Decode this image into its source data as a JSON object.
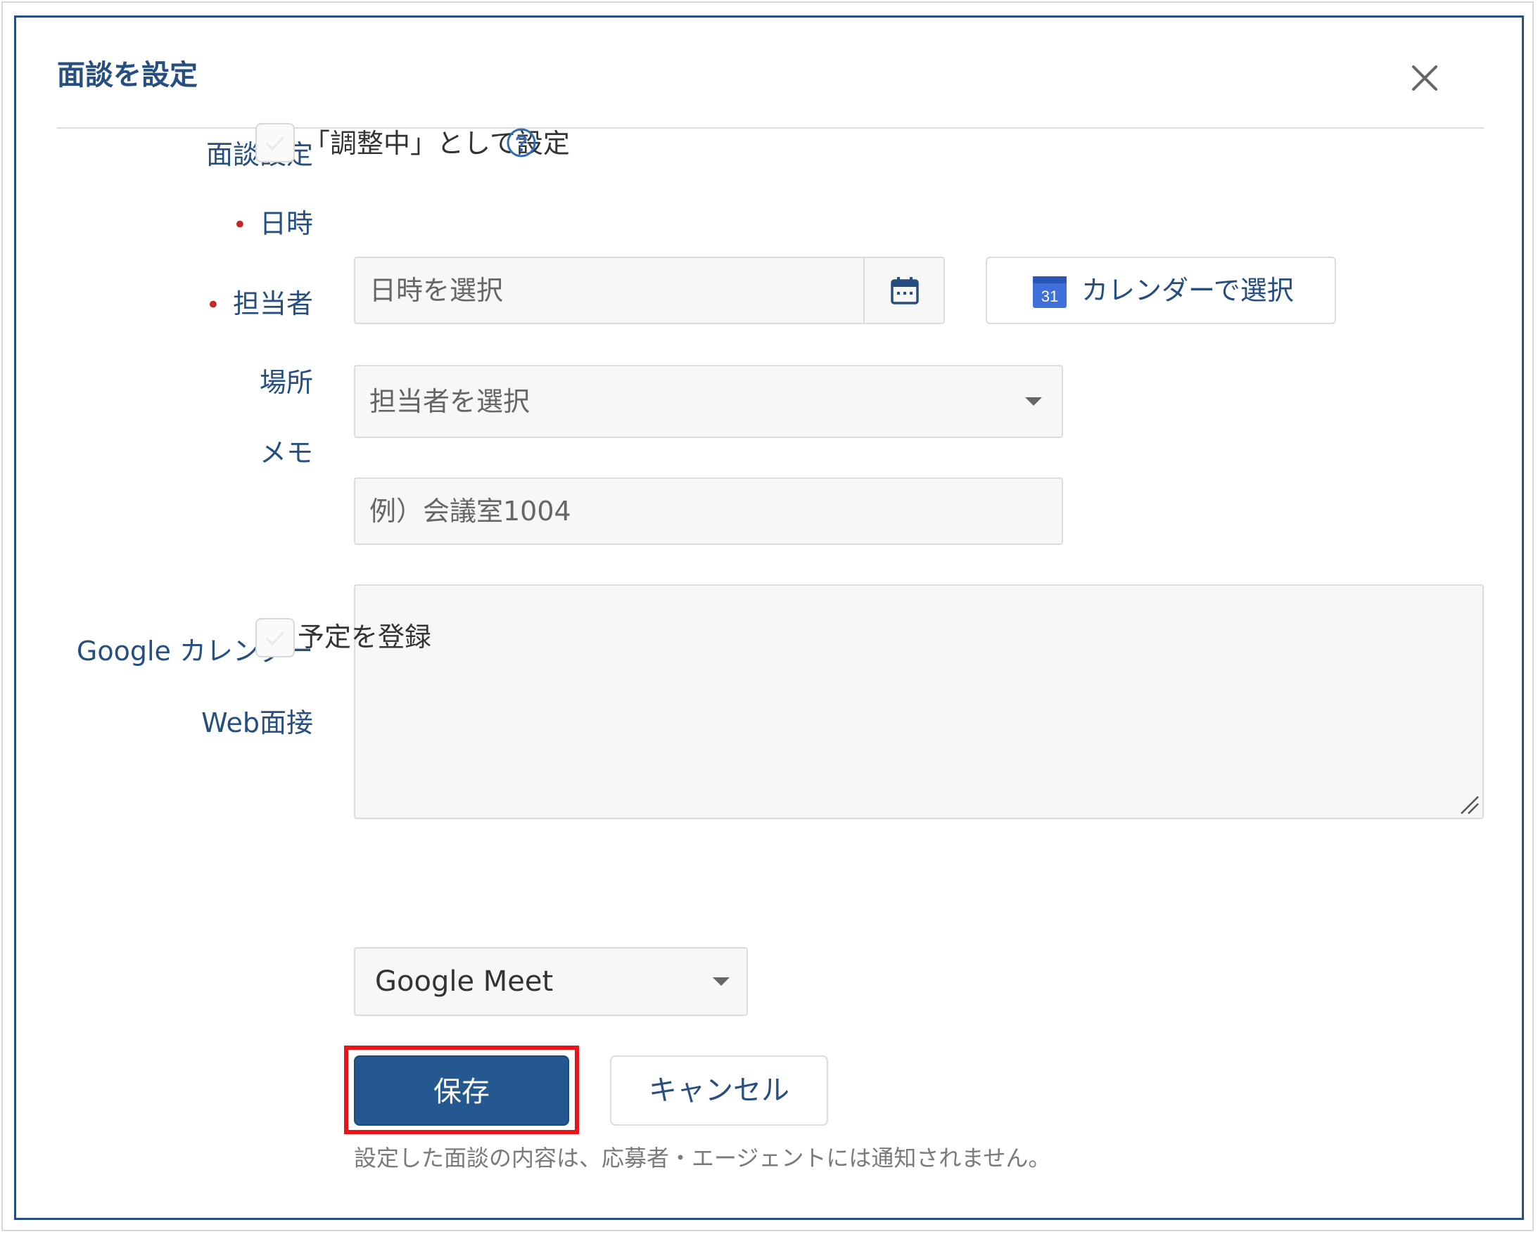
{
  "modal": {
    "title": "面談を設定",
    "close_icon": "close-icon"
  },
  "interview_setting": {
    "label": "面談設定",
    "checkbox_checked": false,
    "checkbox_text": "「調整中」として設定",
    "help_icon": "question-circle-icon"
  },
  "datetime": {
    "required_mark": "•",
    "label": "日時",
    "placeholder": "日時を選択",
    "calendar_icon": "calendar-icon",
    "gcal_button_icon_text": "31",
    "gcal_button_label": "カレンダーで選択"
  },
  "assignee": {
    "required_mark": "•",
    "label": "担当者",
    "placeholder": "担当者を選択"
  },
  "location": {
    "label": "場所",
    "placeholder": "例）会議室1004"
  },
  "memo": {
    "label": "メモ",
    "value": ""
  },
  "google_calendar": {
    "label": "Google カレンダー",
    "checkbox_checked": false,
    "checkbox_text": "予定を登録"
  },
  "web_interview": {
    "label": "Web面接",
    "selected": "Google Meet"
  },
  "actions": {
    "save_label": "保存",
    "cancel_label": "キャンセル"
  },
  "notice": "設定した面談の内容は、応募者・エージェントには通知されません。",
  "colors": {
    "brand": "#264f80",
    "primary_button": "#24588f",
    "required": "#c0282a",
    "highlight": "#e8141a"
  }
}
